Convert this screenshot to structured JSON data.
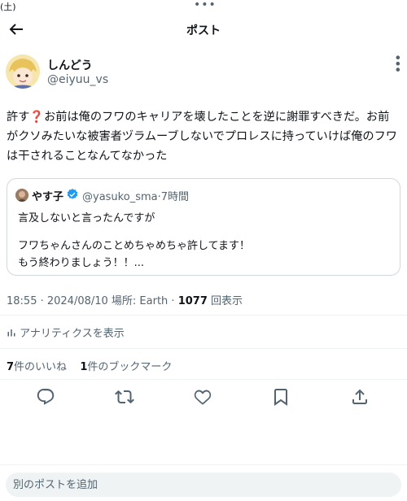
{
  "status": {
    "time_fragment": "(土)",
    "dots": "•••"
  },
  "header": {
    "title": "ポスト"
  },
  "author": {
    "name": "しんどう",
    "handle": "@eiyuu_vs"
  },
  "tweet": {
    "line1_before": "許す",
    "line1_mark": "❓",
    "line1_after": "お前は俺のフワのキャリアを壊したことを逆に謝罪すべきだ。お前",
    "line2": "がクソみたいな被害者ヅラムーブしないでプロレスに持っていけば俺のフワ",
    "line3": "は干されることなんてなかった"
  },
  "quote": {
    "name": "やす子",
    "handle_time": "@yasuko_sma·7時間",
    "line1": "言及しないと言ったんですが",
    "line2": "フワちゃんさんのことめちゃめちゃ許してます！",
    "line3": "もう終わりましょう！！..."
  },
  "meta": {
    "datetime": "18:55 · 2024/08/10 場所: Earth · ",
    "views": "1077",
    "views_label": " 回表示"
  },
  "analytics": {
    "label": "アナリティクスを表示"
  },
  "counts": {
    "likes": "7",
    "likes_label": "件のいいね",
    "bookmarks": "1",
    "bookmarks_label": "件のブックマーク"
  },
  "reply": {
    "placeholder": "別のポストを追加"
  },
  "colors": {
    "accent": "#1d9bf0",
    "muted": "#536471",
    "text": "#0f1419",
    "red_mark": "#e0245e"
  },
  "icons": [
    "back-arrow-icon",
    "more-icon",
    "verified-icon",
    "analytics-icon",
    "reply-icon",
    "repost-icon",
    "like-icon",
    "bookmark-icon",
    "share-icon"
  ]
}
